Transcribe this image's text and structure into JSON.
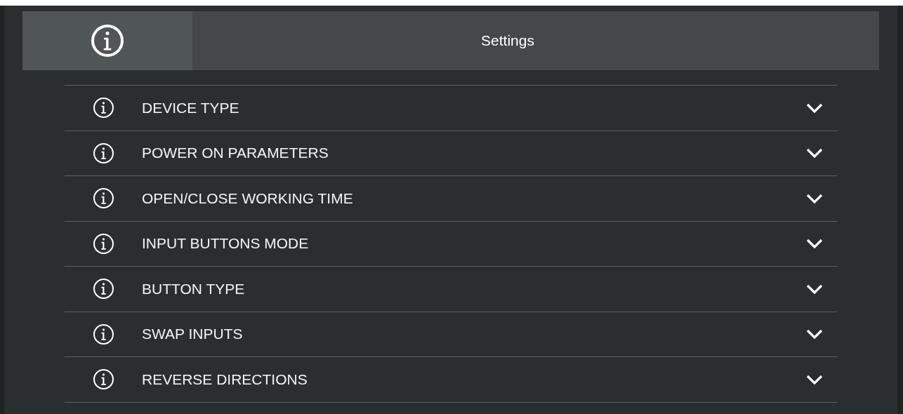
{
  "header": {
    "title": "Settings"
  },
  "sections": [
    {
      "label": "DEVICE TYPE",
      "expanded": false
    },
    {
      "label": "POWER ON PARAMETERS",
      "expanded": false
    },
    {
      "label": "OPEN/CLOSE WORKING TIME",
      "expanded": false
    },
    {
      "label": "INPUT BUTTONS MODE",
      "expanded": false
    },
    {
      "label": "BUTTON TYPE",
      "expanded": false
    },
    {
      "label": "SWAP INPUTS",
      "expanded": false
    },
    {
      "label": "REVERSE DIRECTIONS",
      "expanded": false
    }
  ]
}
